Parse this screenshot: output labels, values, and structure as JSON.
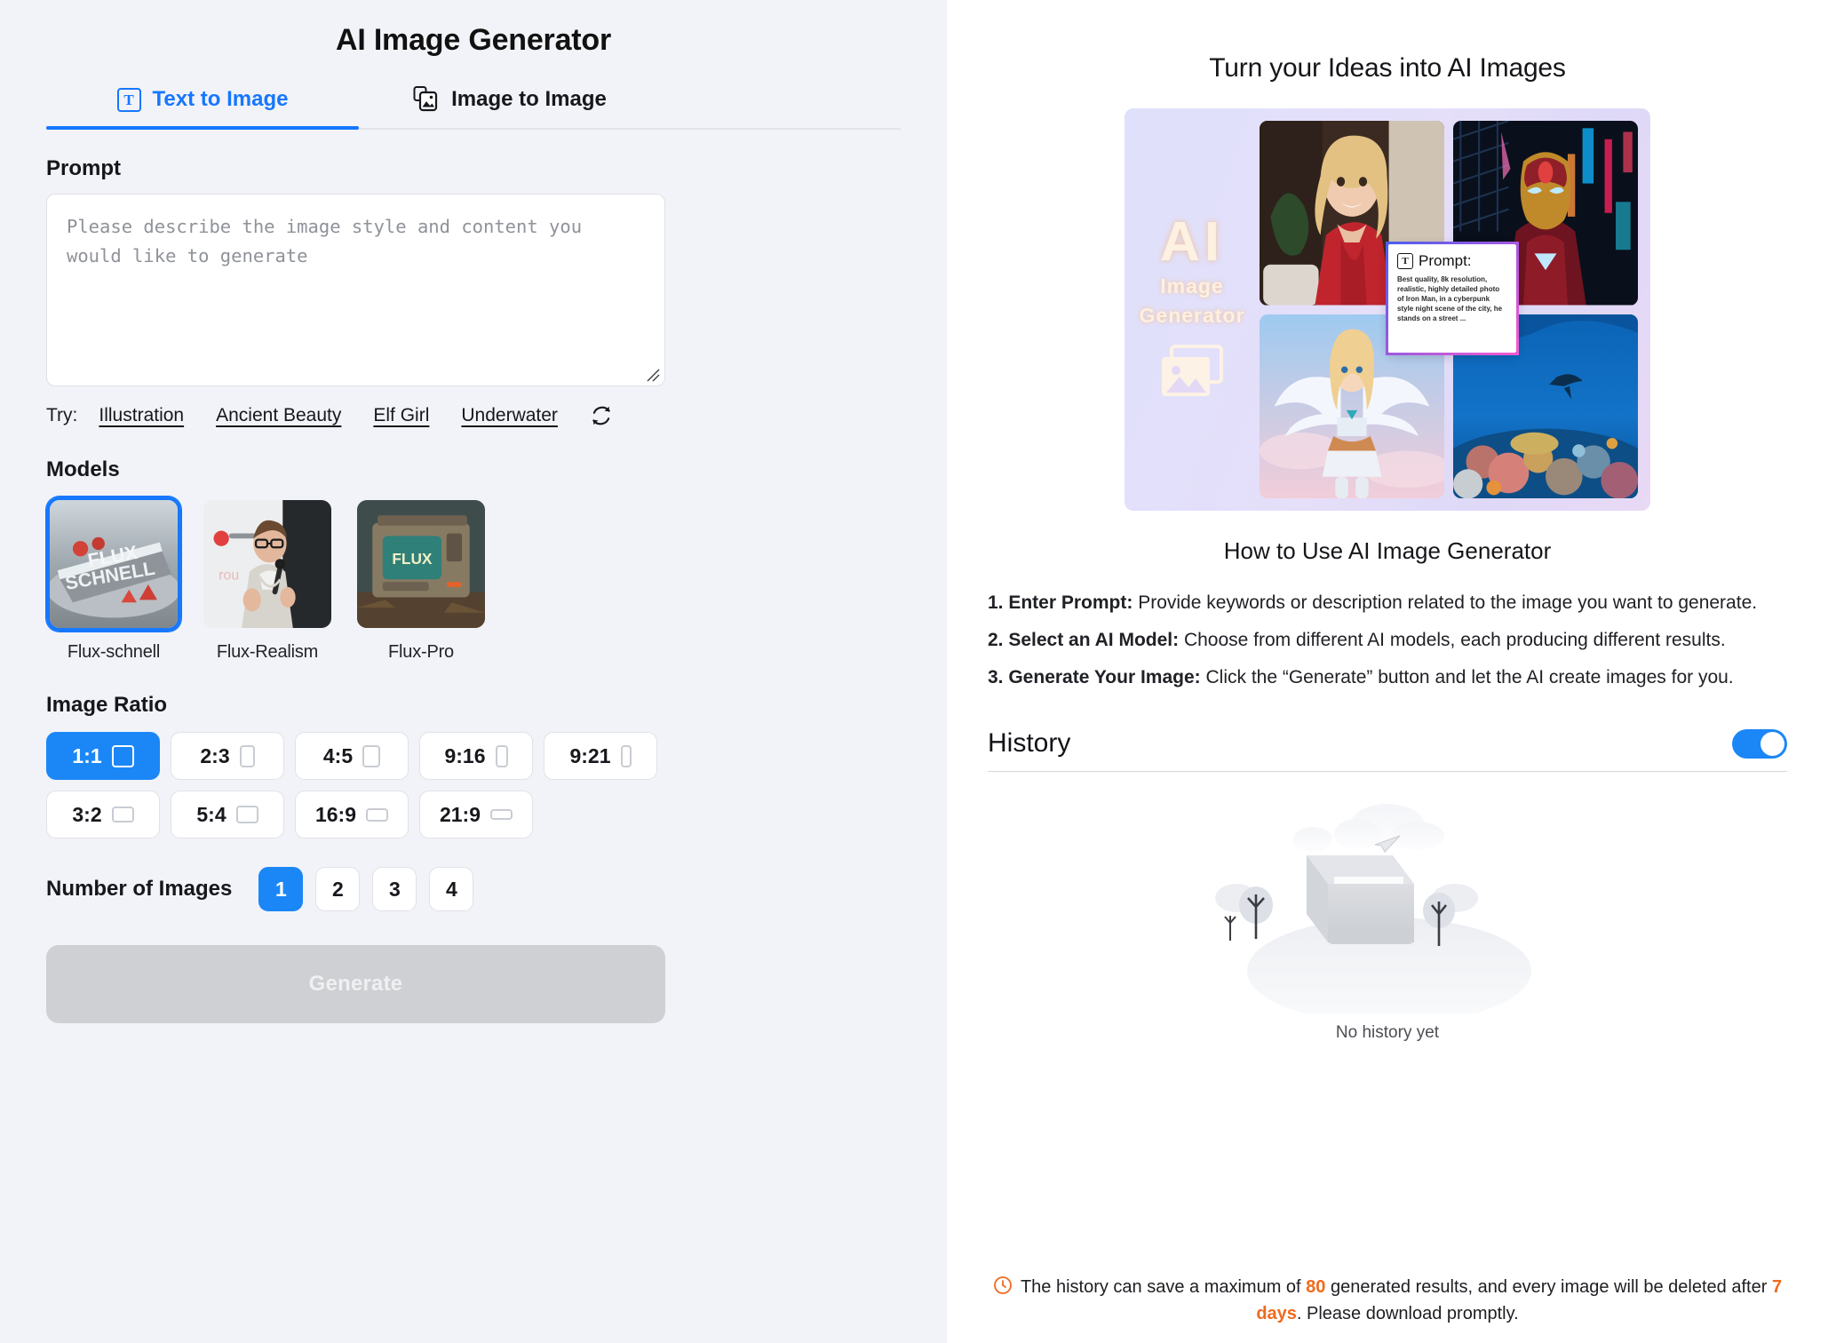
{
  "left": {
    "title": "AI Image Generator",
    "tabs": [
      {
        "label": "Text to Image",
        "icon": "text-icon",
        "active": true
      },
      {
        "label": "Image to Image",
        "icon": "image-to-image-icon",
        "active": false
      }
    ],
    "prompt": {
      "label": "Prompt",
      "value": "",
      "placeholder": "Please describe the image style and content you would like to generate"
    },
    "try": {
      "label": "Try:",
      "links": [
        "Illustration",
        "Ancient Beauty",
        "Elf Girl",
        "Underwater"
      ],
      "refresh_icon": "refresh-icon"
    },
    "models": {
      "label": "Models",
      "items": [
        {
          "name": "Flux-schnell",
          "selected": true
        },
        {
          "name": "Flux-Realism",
          "selected": false
        },
        {
          "name": "Flux-Pro",
          "selected": false
        }
      ]
    },
    "ratio": {
      "label": "Image Ratio",
      "selected": "1:1",
      "options": [
        "1:1",
        "2:3",
        "4:5",
        "9:16",
        "9:21",
        "3:2",
        "5:4",
        "16:9",
        "21:9"
      ]
    },
    "count": {
      "label": "Number of Images",
      "selected": "1",
      "options": [
        "1",
        "2",
        "3",
        "4"
      ]
    },
    "generate_label": "Generate"
  },
  "right": {
    "hero_title": "Turn your Ideas into AI Images",
    "hero": {
      "brand_ai": "AI",
      "brand_line1": "Image",
      "brand_line2": "Generator",
      "callout_title": "Prompt:",
      "callout_body": "Best quality, 8k resolution, realistic, highly detailed photo of Iron Man, in a cyberpunk style night scene of the city, he stands on a street ..."
    },
    "howto_title": "How to Use AI Image Generator",
    "howto_steps": [
      {
        "bold": "1. Enter Prompt:",
        "rest": " Provide keywords or description related to the image you want to generate."
      },
      {
        "bold": "2. Select an AI Model:",
        "rest": " Choose from different AI models, each producing different results."
      },
      {
        "bold": "3. Generate Your Image:",
        "rest": " Click the “Generate” button and let the AI create images for you."
      }
    ],
    "history": {
      "title": "History",
      "enabled": true,
      "empty_text": "No history yet"
    },
    "footer": {
      "part1": "The history can save a maximum of ",
      "max": "80",
      "part2": " generated results, and every image will be deleted after ",
      "days": "7 days",
      "part3": ". Please download promptly."
    }
  },
  "colors": {
    "accent": "#1b87f7",
    "tab_active": "#1677ff",
    "warning": "#f06a1e",
    "left_bg": "#f2f3f8",
    "disabled_btn": "#cfd0d3"
  }
}
